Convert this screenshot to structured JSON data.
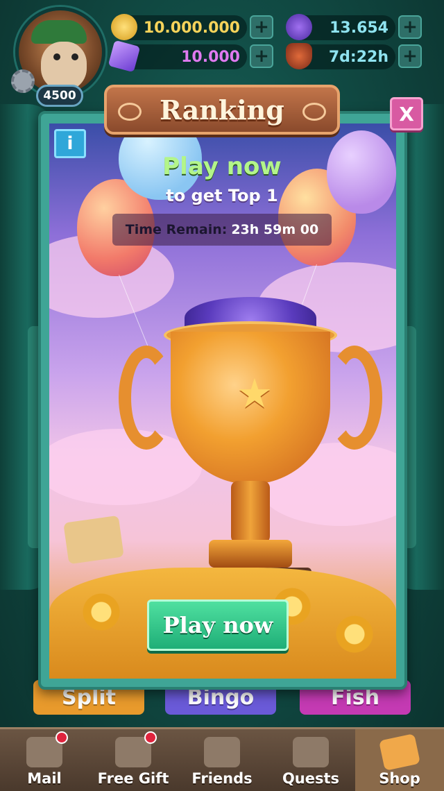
{
  "header": {
    "level": "4500",
    "coins": "10.000.000",
    "gems": "10.000",
    "energy": "13.654",
    "shield_timer": "7d:22h",
    "plus_label": "+"
  },
  "modal": {
    "title": "Ranking",
    "close_label": "X",
    "info_label": "i",
    "headline": "Play now",
    "subline": "to get Top 1",
    "timer_label": "Time Remain:",
    "timer_value": "23h 59m 00",
    "play_button": "Play now"
  },
  "background_buttons": [
    "Split",
    "Bingo",
    "Fish"
  ],
  "nav": {
    "items": [
      {
        "label": "Mail",
        "icon": "mail-icon",
        "badge": true
      },
      {
        "label": "Free Gift",
        "icon": "gift-icon",
        "badge": true
      },
      {
        "label": "Friends",
        "icon": "friends-icon",
        "badge": false
      },
      {
        "label": "Quests",
        "icon": "quests-icon",
        "badge": false
      },
      {
        "label": "Shop",
        "icon": "shop-cart-icon",
        "badge": false
      }
    ]
  },
  "colors": {
    "accent_green": "#b3f58a",
    "modal_frame": "#3fa596",
    "close_pink": "#d85aa2",
    "play_green": "#1fae77"
  }
}
